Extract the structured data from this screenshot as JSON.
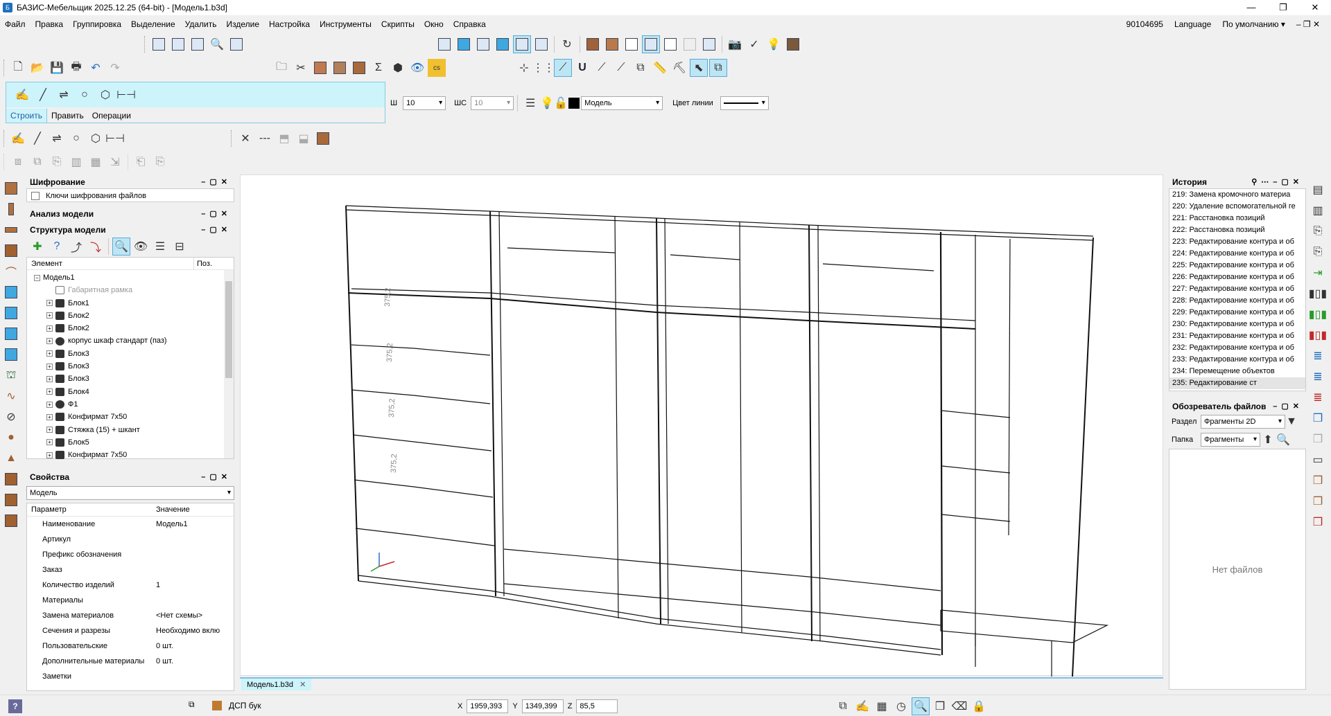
{
  "app": {
    "title": "БАЗИС-Мебельщик 2025.12.25 (64-bit) - [Модель1.b3d]",
    "icon_letter": "Б"
  },
  "window_controls": [
    "—",
    "❐",
    "✕"
  ],
  "menu": [
    "Файл",
    "Правка",
    "Группировка",
    "Выделение",
    "Удалить",
    "Изделие",
    "Настройка",
    "Инструменты",
    "Скрипты",
    "Окно",
    "Справка"
  ],
  "menu_right": {
    "code": "90104695",
    "language": "Language",
    "preset": "По умолчанию ▾",
    "controls": "– ❐ ✕"
  },
  "draw_panel": {
    "tabs": [
      "Строить",
      "Править",
      "Операции"
    ],
    "active_tab": 0
  },
  "line_params": {
    "w_label": "Ш",
    "w_value": "10",
    "ws_label": "ШС",
    "ws_value": "10",
    "layer": "Модель",
    "line_color_label": "Цвет линии"
  },
  "panels": {
    "encryption": {
      "title": "Шифрование",
      "item": "Ключи шифрования файлов"
    },
    "analysis": {
      "title": "Анализ модели"
    },
    "structure": {
      "title": "Структура модели",
      "col_element": "Элемент",
      "col_pos": "Поз.",
      "root": "Модель1",
      "items": [
        {
          "label": "Габаритная рамка",
          "dim": true
        },
        {
          "label": "Блок1"
        },
        {
          "label": "Блок2"
        },
        {
          "label": "Блок2"
        },
        {
          "label": "корпус шкаф стандарт (паз)"
        },
        {
          "label": "Блок3"
        },
        {
          "label": "Блок3"
        },
        {
          "label": "Блок3"
        },
        {
          "label": "Блок4"
        },
        {
          "label": "Ф1"
        },
        {
          "label": "Конфирмат 7x50"
        },
        {
          "label": "Стяжка (15) + шкант"
        },
        {
          "label": "Блок5"
        },
        {
          "label": "Конфирмат 7x50"
        }
      ]
    },
    "properties": {
      "title": "Свойства",
      "selector": "Модель",
      "col_param": "Параметр",
      "col_value": "Значение",
      "rows": [
        {
          "k": "Наименование",
          "v": "Модель1"
        },
        {
          "k": "Артикул",
          "v": ""
        },
        {
          "k": "Префикс обозначения",
          "v": ""
        },
        {
          "k": "Заказ",
          "v": ""
        },
        {
          "k": "Количество изделий",
          "v": "1"
        },
        {
          "k": "Материалы",
          "v": ""
        },
        {
          "k": "Замена материалов",
          "v": "<Нет схемы>"
        },
        {
          "k": "Сечения и разрезы",
          "v": "Необходимо вклю"
        },
        {
          "k": "Пользовательские",
          "v": "0 шт."
        },
        {
          "k": "Дополнительные материалы",
          "v": "0 шт."
        },
        {
          "k": "Заметки",
          "v": ""
        }
      ]
    },
    "history": {
      "title": "История",
      "items": [
        "219:  Замена кромочного материа",
        "220:  Удаление вспомогательной ге",
        "221:  Расстановка позиций",
        "222:  Расстановка позиций",
        "223:  Редактирование контура и об",
        "224:  Редактирование контура и об",
        "225:  Редактирование контура и об",
        "226:  Редактирование контура и об",
        "227:  Редактирование контура и об",
        "228:  Редактирование контура и об",
        "229:  Редактирование контура и об",
        "230:  Редактирование контура и об",
        "231:  Редактирование контура и об",
        "232:  Редактирование контура и об",
        "233:  Редактирование контура и об",
        "234:  Перемещение объектов",
        "235:  Редактирование ст"
      ]
    },
    "file_browser": {
      "title": "Обозреватель файлов",
      "section_label": "Раздел",
      "section_value": "Фрагменты 2D",
      "folder_label": "Папка",
      "folder_value": "Фрагменты",
      "empty": "Нет файлов"
    }
  },
  "viewport": {
    "tab": "Модель1.b3d",
    "dims": [
      "375,2",
      "375,2",
      "375,2",
      "375,2"
    ]
  },
  "status": {
    "material": "ДСП бук",
    "x_label": "X",
    "x": "1959,393",
    "y_label": "Y",
    "y": "1349,399",
    "z_label": "Z",
    "z": "85,5"
  }
}
